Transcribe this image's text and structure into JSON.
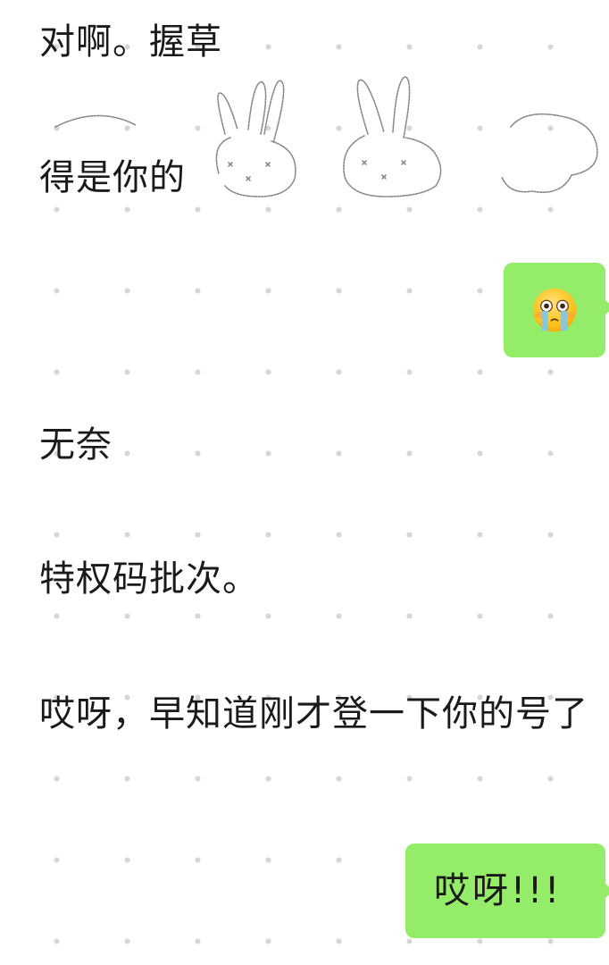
{
  "messages": [
    {
      "side": "left",
      "text": "对啊。握草"
    },
    {
      "side": "left",
      "text": "得是你的"
    },
    {
      "side": "right",
      "icon": "crying-face-emoji"
    },
    {
      "side": "left",
      "text": "无奈"
    },
    {
      "side": "left",
      "text": "特权码批次。"
    },
    {
      "side": "left",
      "text": "哎呀，早知道刚才登一下你的号了"
    },
    {
      "side": "right",
      "text": "哎呀!!!"
    }
  ],
  "sticker": {
    "icon": "bunny-sticker-icon"
  },
  "colors": {
    "bubble": "#95ec69",
    "background": "#ffffff",
    "dots": "#d6d6d6",
    "text": "#1a1a1a"
  }
}
